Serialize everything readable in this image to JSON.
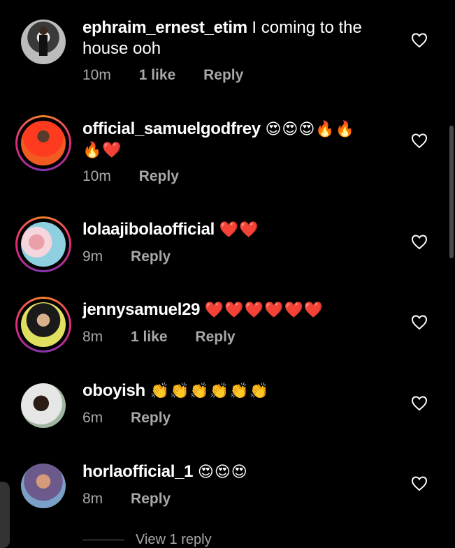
{
  "comments": [
    {
      "username": "ephraim_ernest_etim",
      "text_line1": "I coming to the",
      "text_line2": "house ooh",
      "emoji_line1": "",
      "emoji_line2": "",
      "time": "10m",
      "likes": "1 like",
      "reply": "Reply",
      "ring": false
    },
    {
      "username": "official_samuelgodfrey",
      "text_line1": "",
      "text_line2": "",
      "emoji_line1": "😍😍😍🔥🔥",
      "emoji_line2": "🔥❤️",
      "time": "10m",
      "likes": "",
      "reply": "Reply",
      "ring": true
    },
    {
      "username": "lolaajibolaofficial",
      "text_line1": "",
      "text_line2": "",
      "emoji_line1": "❤️❤️",
      "emoji_line2": "",
      "time": "9m",
      "likes": "",
      "reply": "Reply",
      "ring": true
    },
    {
      "username": "jennysamuel29",
      "text_line1": "",
      "text_line2": "",
      "emoji_line1": "❤️❤️❤️❤️❤️❤️",
      "emoji_line2": "",
      "time": "8m",
      "likes": "1 like",
      "reply": "Reply",
      "ring": true
    },
    {
      "username": "oboyish",
      "text_line1": "",
      "text_line2": "",
      "emoji_line1": "👏👏👏👏👏👏",
      "emoji_line2": "",
      "time": "6m",
      "likes": "",
      "reply": "Reply",
      "ring": false
    },
    {
      "username": "horlaofficial_1",
      "text_line1": "",
      "text_line2": "",
      "emoji_line1": "😍😍😍",
      "emoji_line2": "",
      "time": "8m",
      "likes": "",
      "reply": "Reply",
      "ring": false
    }
  ],
  "view_replies": "View 1 reply",
  "colors": {
    "background": "#000000",
    "text": "#ffffff",
    "meta": "#a8a8a8",
    "heart_outline": "#ffffff"
  },
  "icons": {
    "like": "heart-outline-icon"
  }
}
